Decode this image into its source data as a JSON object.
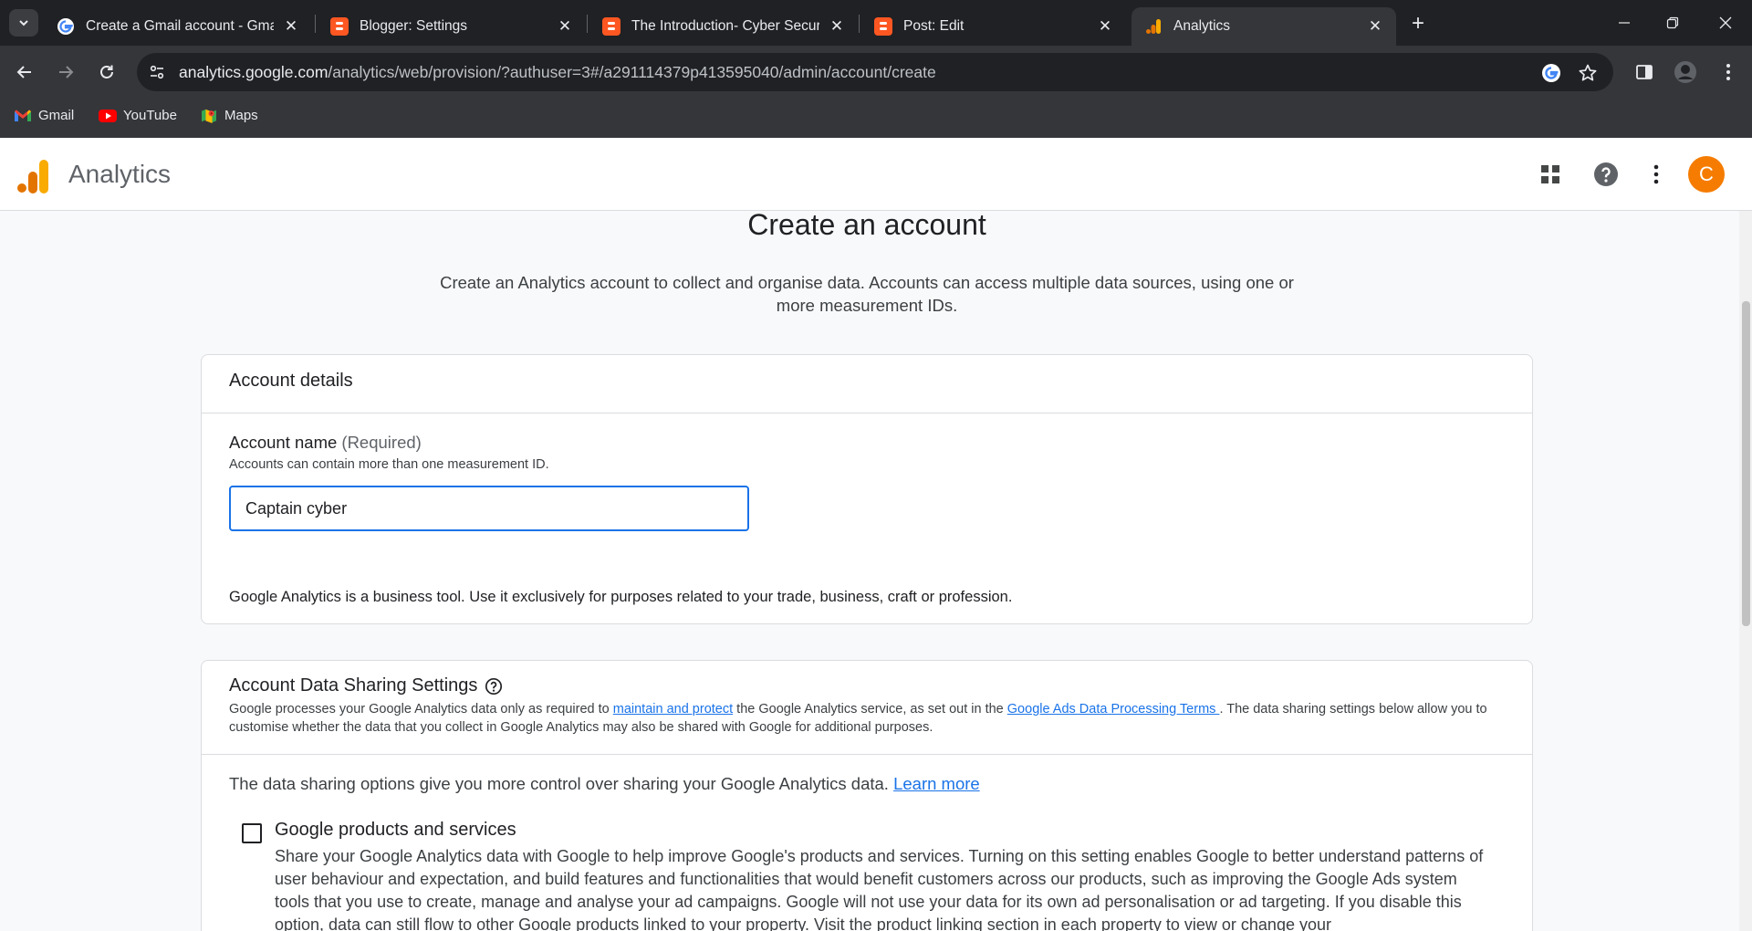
{
  "browser": {
    "tabs": [
      {
        "title": "Create a Gmail account - Gmail",
        "favicon": "google-g-icon",
        "active": false
      },
      {
        "title": "Blogger: Settings",
        "favicon": "blogger-icon",
        "active": false
      },
      {
        "title": "The Introduction- Cyber Securi",
        "favicon": "blogger-icon",
        "active": false
      },
      {
        "title": "Post: Edit",
        "favicon": "blogger-icon",
        "active": false
      },
      {
        "title": "Analytics",
        "favicon": "analytics-icon",
        "active": true
      }
    ],
    "url_host": "analytics.google.com",
    "url_path": "/analytics/web/provision/?authuser=3#/a291114379p413595040/admin/account/create",
    "bookmarks": [
      {
        "label": "Gmail",
        "icon": "gmail-icon"
      },
      {
        "label": "YouTube",
        "icon": "youtube-icon"
      },
      {
        "label": "Maps",
        "icon": "maps-icon"
      }
    ]
  },
  "app": {
    "title": "Analytics",
    "avatar_letter": "C",
    "accent_color": "#f57c00"
  },
  "page": {
    "heading": "Create an account",
    "description": "Create an Analytics account to collect and organise data. Accounts can access multiple data sources, using one or more measurement IDs."
  },
  "account_details": {
    "section_title": "Account details",
    "field_label": "Account name",
    "field_required": "(Required)",
    "field_hint": "Accounts can contain more than one measurement ID.",
    "account_name_value": "Captain cyber",
    "business_note": "Google Analytics is a business tool. Use it exclusively for purposes related to your trade, business, craft or profession."
  },
  "data_sharing": {
    "section_title": "Account Data Sharing Settings",
    "desc_part1": "Google processes your Google Analytics data only as required to ",
    "desc_link1": "maintain and protect",
    "desc_part2": " the Google Analytics service, as set out in the ",
    "desc_link2": "Google Ads Data Processing Terms ",
    "desc_part3": ". The data sharing settings below allow you to customise whether the data that you collect in Google Analytics may also be shared with Google for additional purposes.",
    "options_intro": "The data sharing options give you more control over sharing your Google Analytics data.",
    "learn_more": "Learn more",
    "option_title": "Google products and services",
    "option_checked": false,
    "option_body": "Share your Google Analytics data with Google to help improve Google's products and services. Turning on this setting enables Google to better understand patterns of user behaviour and expectation, and build features and functionalities that would benefit customers across our products, such as improving the Google Ads system tools that you use to create, manage and analyse your ad campaigns. Google will not use your data for its own ad personalisation or ad targeting. If you disable this option, data can still flow to other Google products linked to your property. Visit the product linking section in each property to view or change your"
  }
}
